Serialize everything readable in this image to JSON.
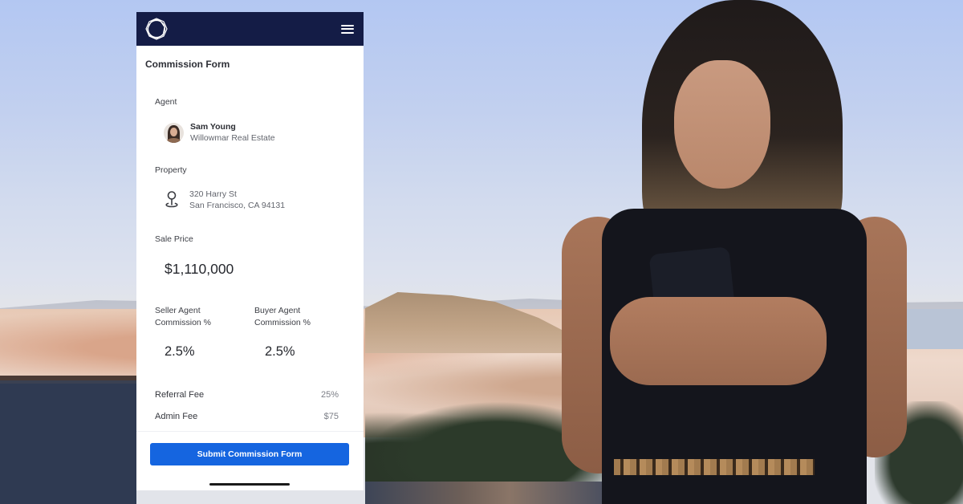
{
  "app": {
    "logo_icon": "ring-logo-icon",
    "menu_icon": "hamburger-menu-icon",
    "header_color": "#141c46",
    "accent_color": "#1565e0"
  },
  "form": {
    "title": "Commission Form",
    "agent": {
      "label": "Agent",
      "name": "Sam Young",
      "company": "Willowmar Real Estate",
      "avatar_icon": "agent-avatar"
    },
    "property": {
      "label": "Property",
      "icon": "map-pin-icon",
      "address_line1": "320 Harry St",
      "address_line2": "San Francisco, CA 94131"
    },
    "sale_price": {
      "label": "Sale Price",
      "value": "$1,110,000"
    },
    "seller_commission": {
      "label": "Seller Agent Commission %",
      "value": "2.5%"
    },
    "buyer_commission": {
      "label": "Buyer Agent Commission %",
      "value": "2.5%"
    },
    "fees": [
      {
        "label": "Referral Fee",
        "value": "25%"
      },
      {
        "label": "Admin Fee",
        "value": "$75"
      }
    ],
    "submit_label": "Submit Commission Form"
  }
}
